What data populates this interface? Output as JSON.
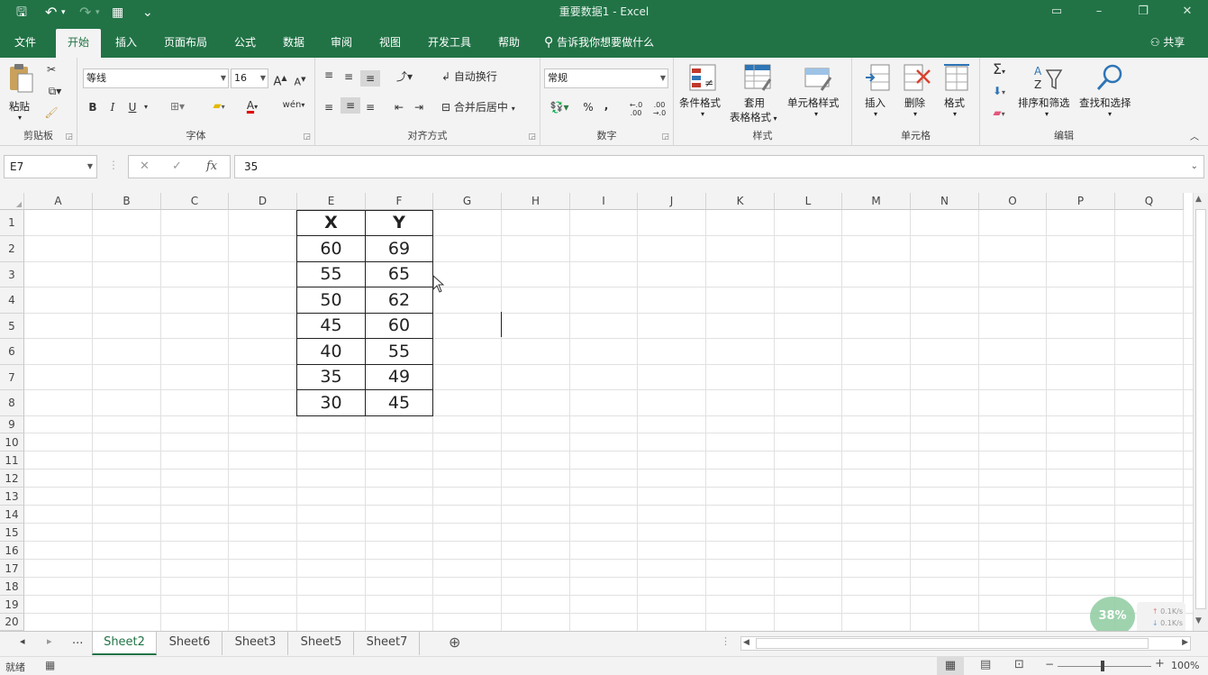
{
  "app": {
    "title": "重要数据1  -  Excel",
    "quick_access": {
      "save": "🖫",
      "undo": "↶",
      "redo": "↷",
      "calc": "▦",
      "customize": "⌄"
    },
    "window_buttons": {
      "ribbon_display": "▭",
      "minimize": "–",
      "restore": "❐",
      "close": "✕"
    }
  },
  "tabs": [
    {
      "label": "文件"
    },
    {
      "label": "开始"
    },
    {
      "label": "插入"
    },
    {
      "label": "页面布局"
    },
    {
      "label": "公式"
    },
    {
      "label": "数据"
    },
    {
      "label": "审阅"
    },
    {
      "label": "视图"
    },
    {
      "label": "开发工具"
    },
    {
      "label": "帮助"
    }
  ],
  "tell_me": "告诉我你想要做什么",
  "share": "共享",
  "ribbon": {
    "clipboard": {
      "paste": "粘贴",
      "group": "剪贴板"
    },
    "font": {
      "name": "等线",
      "size": "16",
      "bold": "B",
      "italic": "I",
      "underline": "U",
      "grow": "A",
      "shrink": "A",
      "wen": "wén",
      "group": "字体"
    },
    "alignment": {
      "wrap": "自动换行",
      "merge": "合并后居中",
      "group": "对齐方式"
    },
    "number": {
      "format": "常规",
      "percent": "%",
      "comma": ",",
      "inc_dec": "←.0 .00",
      "dec_dec": ".00 →.0",
      "group": "数字"
    },
    "styles": {
      "conditional": "条件格式",
      "table_format_1": "套用",
      "table_format_2": "表格格式",
      "cell_styles": "单元格样式",
      "group": "样式"
    },
    "cells": {
      "insert": "插入",
      "delete": "删除",
      "format": "格式",
      "group": "单元格"
    },
    "editing": {
      "sort": "排序和筛选",
      "find": "查找和选择",
      "group": "编辑"
    }
  },
  "formula_bar": {
    "name_box": "E7",
    "cancel": "✕",
    "enter": "✓",
    "fx": "fx",
    "value": "35"
  },
  "columns": [
    "A",
    "B",
    "C",
    "D",
    "E",
    "F",
    "G",
    "H",
    "I",
    "J",
    "K",
    "L",
    "M",
    "N",
    "O",
    "P",
    "Q"
  ],
  "rows": [
    "1",
    "2",
    "3",
    "4",
    "5",
    "6",
    "7",
    "8",
    "9",
    "10",
    "11",
    "12",
    "13",
    "14",
    "15",
    "16",
    "17",
    "18",
    "19",
    "20"
  ],
  "table": {
    "header": [
      "X",
      "Y"
    ],
    "data": [
      [
        "60",
        "69"
      ],
      [
        "55",
        "65"
      ],
      [
        "50",
        "62"
      ],
      [
        "45",
        "60"
      ],
      [
        "40",
        "55"
      ],
      [
        "35",
        "49"
      ],
      [
        "30",
        "45"
      ]
    ]
  },
  "sheets": [
    {
      "label": "Sheet2",
      "active": true
    },
    {
      "label": "Sheet6"
    },
    {
      "label": "Sheet3"
    },
    {
      "label": "Sheet5"
    },
    {
      "label": "Sheet7"
    }
  ],
  "sheet_nav": {
    "prev": "◂",
    "next": "▸",
    "more": "..."
  },
  "status": {
    "ready": "就绪",
    "zoom": "100%",
    "overlay_percent": "38%",
    "net_up": "0.1K/s",
    "net_down": "0.1K/s"
  },
  "colors": {
    "accent": "#217346",
    "grid": "#e1e1e1",
    "header_bg": "#f3f3f3"
  }
}
